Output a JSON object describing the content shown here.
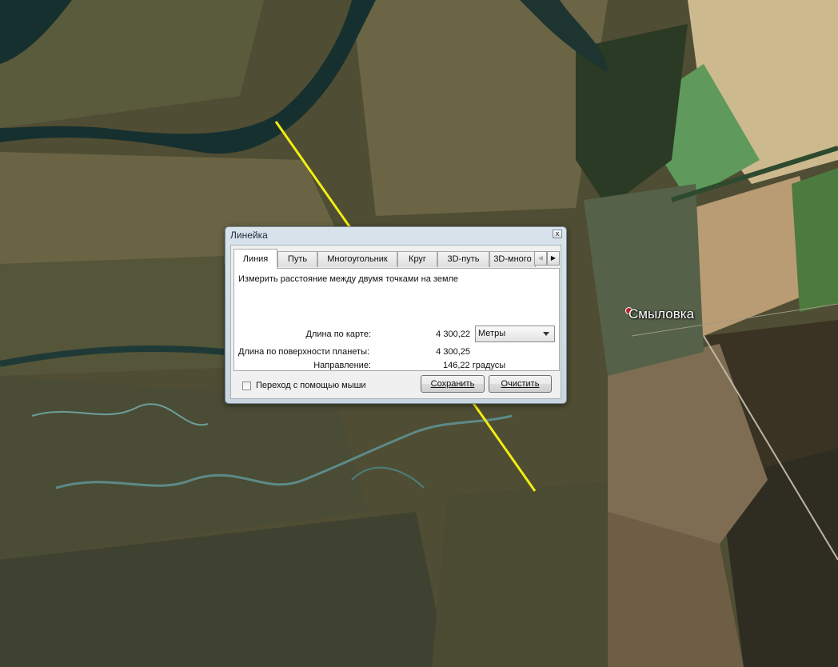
{
  "map": {
    "place_label": "Смыловка",
    "measure_line_color": "#f2ee12"
  },
  "dialog": {
    "title": "Линейка",
    "close_label": "x",
    "tabs": [
      {
        "label": "Линия",
        "active": true
      },
      {
        "label": "Путь",
        "active": false
      },
      {
        "label": "Многоугольник",
        "active": false
      },
      {
        "label": "Круг",
        "active": false
      },
      {
        "label": "3D-путь",
        "active": false
      },
      {
        "label": "3D-много",
        "active": false
      }
    ],
    "tab_scroll_left": "◀",
    "tab_scroll_right": "▶",
    "description": "Измерить расстояние между двумя точками на земле",
    "map_length_label": "Длина по карте:",
    "map_length_value": "4 300,22",
    "units_selected": "Метры",
    "ground_length_label": "Длина по поверхности планеты:",
    "ground_length_value": "4 300,25",
    "heading_label": "Направление:",
    "heading_value": "146,22 градусы",
    "mouse_navigation_label": "Переход с помощью мыши",
    "mouse_navigation_checked": false,
    "save_label": "Сохранить",
    "clear_label": "Очистить"
  }
}
